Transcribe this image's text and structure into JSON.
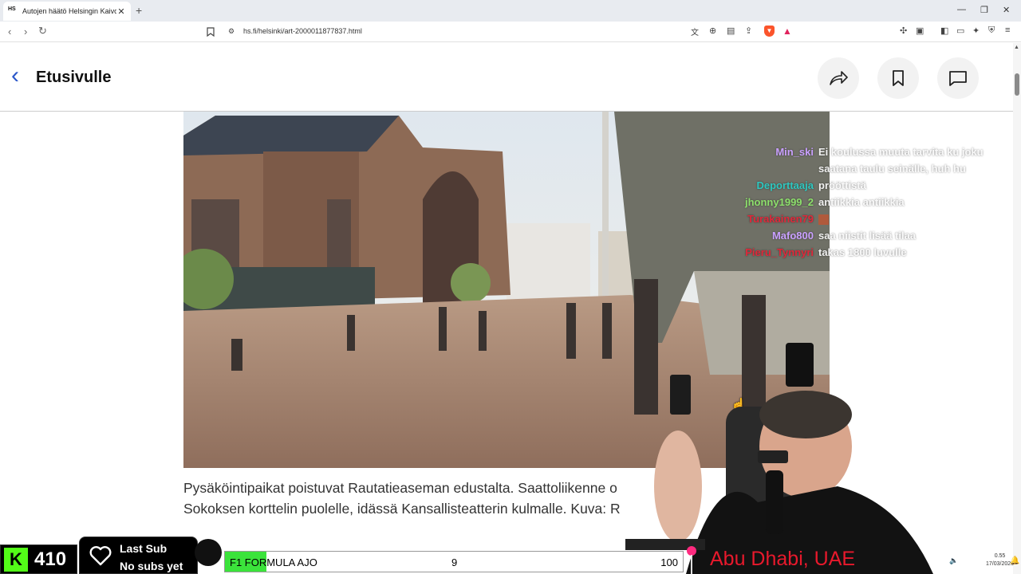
{
  "browser": {
    "tab_title": "Autojen häätö Helsingin Kaivokadulta",
    "tab_favicon": "HS",
    "url": "hs.fi/helsinki/art-2000011877837.html"
  },
  "site_header": {
    "back_label": "Etusivulle",
    "icons": [
      "share-icon",
      "bookmark-icon",
      "comment-icon"
    ]
  },
  "article": {
    "caption_line1": "Pysäköintipaikat poistuvat Rautatieaseman edustalta. Saattoliikenne o",
    "caption_line2": "Sokoksen korttelin puolelle, idässä Kansallisteatterin kulmalle. Kuva: R"
  },
  "chat": [
    {
      "user": "Min_ski",
      "msg": "Ei koulussa muuta tarvita ku joku saatana taulu seinälle, huh hu",
      "color": "#c9a0ff"
    },
    {
      "user": "Deporttaaja",
      "msg": "prööttistä",
      "color": "#2ec7c0"
    },
    {
      "user": "jhonny1999_2",
      "msg": "antiikkia antiikkia",
      "color": "#8de06c"
    },
    {
      "user": "Turakainen79",
      "msg": "",
      "color": "#e0283a"
    },
    {
      "user": "Mafo800",
      "msg": "saa niistit lisää tilaa",
      "color": "#c9a0ff"
    },
    {
      "user": "Pieru_Tynnyri",
      "msg": "takas 1800 luvulle",
      "color": "#e0283a"
    }
  ],
  "stream": {
    "kick_count": "410",
    "sub_line1": "Last Sub",
    "sub_line2": "No subs yet",
    "f1_label": "F1 FORMULA AJO",
    "f1_mid": "9",
    "f1_right": "100",
    "location": "Abu Dhabi, UAE",
    "accent_green": "#53fc18",
    "location_color": "#e8192c"
  },
  "tray": {
    "time": "0.55",
    "date": "17/03/2026"
  }
}
